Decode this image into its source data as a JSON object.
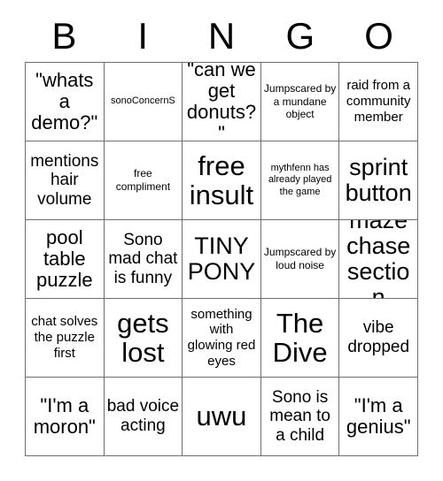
{
  "card": {
    "title": "BINGO",
    "columns": [
      "B",
      "I",
      "N",
      "G",
      "O"
    ],
    "grid_lines": {
      "border_color": "#6f6f6f",
      "background": "#ffffff",
      "text_color": "#000000"
    },
    "rows": [
      [
        {
          "text": "\"whats a demo?\"",
          "size": "lg"
        },
        {
          "text": "sonoConcernS",
          "size": "xxs"
        },
        {
          "text": "\"can we get donuts?\"",
          "size": "lg"
        },
        {
          "text": "Jumpscared by a mundane object",
          "size": "xs"
        },
        {
          "text": "raid from a community member",
          "size": "sm"
        }
      ],
      [
        {
          "text": "mentions hair volume",
          "size": "md"
        },
        {
          "text": "free compliment",
          "size": "xs"
        },
        {
          "text": "free insult",
          "size": "xxl"
        },
        {
          "text": "mythfenn has already played the game",
          "size": "xxs"
        },
        {
          "text": "sprint button",
          "size": "xl"
        }
      ],
      [
        {
          "text": "pool table puzzle",
          "size": "lg"
        },
        {
          "text": "Sono mad chat is funny",
          "size": "md"
        },
        {
          "text": "TINY PONY",
          "size": "xl"
        },
        {
          "text": "Jumpscared by loud noise",
          "size": "xs"
        },
        {
          "text": "maze chase section",
          "size": "xl"
        }
      ],
      [
        {
          "text": "chat solves the puzzle first",
          "size": "sm"
        },
        {
          "text": "gets lost",
          "size": "xxl"
        },
        {
          "text": "something with glowing red eyes",
          "size": "sm"
        },
        {
          "text": "The Dive",
          "size": "xxl"
        },
        {
          "text": "vibe dropped",
          "size": "md"
        }
      ],
      [
        {
          "text": "\"I'm a moron\"",
          "size": "lg"
        },
        {
          "text": "bad voice acting",
          "size": "md"
        },
        {
          "text": "uwu",
          "size": "xxl"
        },
        {
          "text": "Sono is mean to a child",
          "size": "md"
        },
        {
          "text": "\"I'm a genius\"",
          "size": "lg"
        }
      ]
    ]
  }
}
